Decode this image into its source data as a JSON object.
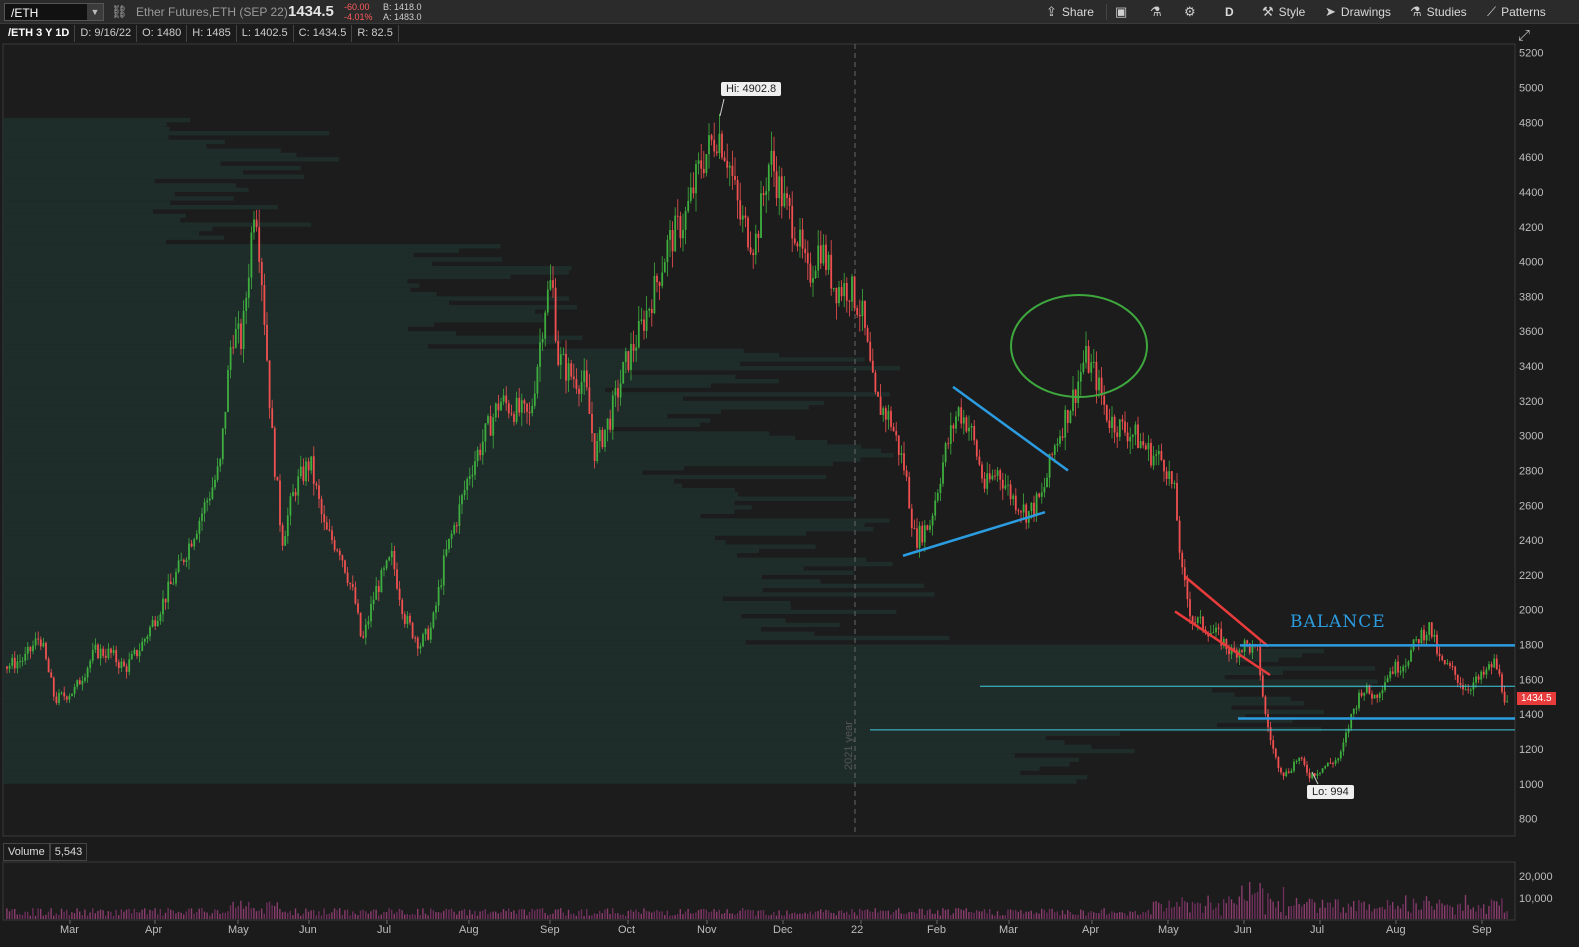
{
  "toolbar": {
    "symbol": "/ETH",
    "description": "Ether Futures,ETH (SEP 22)",
    "last": "1434.5",
    "change_net": "-60.00",
    "change_pct": "-4.01%",
    "bid": "B: 1418.0",
    "ask": "A: 1483.0",
    "share": "Share",
    "aggregation": "D",
    "style": "Style",
    "drawings": "Drawings",
    "studies": "Studies",
    "patterns": "Patterns"
  },
  "info": {
    "title": "/ETH 3 Y 1D",
    "date": "D: 9/16/22",
    "open": "O: 1480",
    "high": "H: 1485",
    "low": "L: 1402.5",
    "close": "C: 1434.5",
    "range": "R: 82.5"
  },
  "annotations": {
    "hi": "Hi: 4902.8",
    "lo": "Lo: 994",
    "balance": "BALANCE",
    "year_marker": "2021 year",
    "price_tag": "1434.5"
  },
  "volume": {
    "label": "Volume",
    "value": "5,543"
  },
  "chart_data": {
    "type": "candlestick",
    "y_ticks": [
      5200,
      5000,
      4800,
      4600,
      4400,
      4200,
      4000,
      3800,
      3600,
      3400,
      3200,
      3000,
      2800,
      2600,
      2400,
      2200,
      2000,
      1800,
      1600,
      1400,
      1200,
      1000,
      800
    ],
    "ylim": [
      700,
      5250
    ],
    "volume_ticks": [
      "20,000",
      "10,000"
    ],
    "x_months": [
      "Mar",
      "Apr",
      "May",
      "Jun",
      "Jul",
      "Aug",
      "Sep",
      "Oct",
      "Nov",
      "Dec",
      "22",
      "Feb",
      "Mar",
      "Apr",
      "May",
      "Jun",
      "Jul",
      "Aug",
      "Sep"
    ],
    "path": [
      [
        0,
        1660
      ],
      [
        25,
        1720
      ],
      [
        40,
        1850
      ],
      [
        55,
        1480
      ],
      [
        75,
        1540
      ],
      [
        95,
        1760
      ],
      [
        110,
        1750
      ],
      [
        125,
        1660
      ],
      [
        140,
        1780
      ],
      [
        160,
        2010
      ],
      [
        180,
        2250
      ],
      [
        205,
        2600
      ],
      [
        220,
        2820
      ],
      [
        232,
        3600
      ],
      [
        242,
        3540
      ],
      [
        250,
        4050
      ],
      [
        255,
        4400
      ],
      [
        262,
        3900
      ],
      [
        272,
        3000
      ],
      [
        282,
        2400
      ],
      [
        295,
        2700
      ],
      [
        310,
        2850
      ],
      [
        325,
        2450
      ],
      [
        340,
        2350
      ],
      [
        355,
        2050
      ],
      [
        362,
        1800
      ],
      [
        375,
        2100
      ],
      [
        392,
        2300
      ],
      [
        405,
        1950
      ],
      [
        420,
        1800
      ],
      [
        432,
        1900
      ],
      [
        445,
        2300
      ],
      [
        458,
        2550
      ],
      [
        470,
        2800
      ],
      [
        485,
        3000
      ],
      [
        500,
        3200
      ],
      [
        515,
        3150
      ],
      [
        530,
        3100
      ],
      [
        545,
        3750
      ],
      [
        552,
        3900
      ],
      [
        558,
        3450
      ],
      [
        570,
        3350
      ],
      [
        585,
        3300
      ],
      [
        595,
        2900
      ],
      [
        610,
        3100
      ],
      [
        625,
        3400
      ],
      [
        640,
        3600
      ],
      [
        655,
        3850
      ],
      [
        668,
        4100
      ],
      [
        685,
        4250
      ],
      [
        700,
        4550
      ],
      [
        718,
        4750
      ],
      [
        728,
        4600
      ],
      [
        740,
        4250
      ],
      [
        755,
        4100
      ],
      [
        770,
        4600
      ],
      [
        783,
        4350
      ],
      [
        795,
        4200
      ],
      [
        808,
        3900
      ],
      [
        820,
        4100
      ],
      [
        835,
        3850
      ],
      [
        850,
        3850
      ],
      [
        862,
        3700
      ],
      [
        875,
        3200
      ],
      [
        890,
        3100
      ],
      [
        905,
        2800
      ],
      [
        915,
        2400
      ],
      [
        930,
        2500
      ],
      [
        945,
        2900
      ],
      [
        958,
        3150
      ],
      [
        970,
        3050
      ],
      [
        985,
        2700
      ],
      [
        998,
        2800
      ],
      [
        1012,
        2650
      ],
      [
        1028,
        2550
      ],
      [
        1042,
        2650
      ],
      [
        1055,
        2950
      ],
      [
        1065,
        3100
      ],
      [
        1075,
        3250
      ],
      [
        1085,
        3450
      ],
      [
        1095,
        3350
      ],
      [
        1108,
        3100
      ],
      [
        1120,
        3050
      ],
      [
        1135,
        3000
      ],
      [
        1150,
        2900
      ],
      [
        1165,
        2850
      ],
      [
        1175,
        2650
      ],
      [
        1182,
        2200
      ],
      [
        1192,
        1950
      ],
      [
        1205,
        1900
      ],
      [
        1218,
        1850
      ],
      [
        1232,
        1750
      ],
      [
        1245,
        1800
      ],
      [
        1258,
        1750
      ],
      [
        1265,
        1400
      ],
      [
        1275,
        1150
      ],
      [
        1285,
        1050
      ],
      [
        1298,
        1150
      ],
      [
        1310,
        1050
      ],
      [
        1325,
        1100
      ],
      [
        1340,
        1150
      ],
      [
        1352,
        1400
      ],
      [
        1362,
        1550
      ],
      [
        1375,
        1500
      ],
      [
        1390,
        1650
      ],
      [
        1405,
        1700
      ],
      [
        1420,
        1850
      ],
      [
        1430,
        1900
      ],
      [
        1440,
        1700
      ],
      [
        1452,
        1650
      ],
      [
        1465,
        1550
      ],
      [
        1480,
        1600
      ],
      [
        1495,
        1700
      ],
      [
        1508,
        1434
      ]
    ],
    "lines": [
      {
        "color": "#2c9ce0",
        "from": [
          953,
          3280
        ],
        "to": [
          1068,
          2800
        ]
      },
      {
        "color": "#2c9ce0",
        "from": [
          903,
          2310
        ],
        "to": [
          1045,
          2560
        ]
      },
      {
        "color": "#e83b3b",
        "from": [
          1185,
          2190
        ],
        "to": [
          1268,
          1790
        ]
      },
      {
        "color": "#e83b3b",
        "from": [
          1175,
          1990
        ],
        "to": [
          1270,
          1625
        ]
      },
      {
        "color": "#2c9ce0",
        "from": [
          1240,
          1795
        ],
        "to": [
          1515,
          1795
        ]
      },
      {
        "color": "#2c9ce0",
        "from": [
          1238,
          1375
        ],
        "to": [
          1515,
          1375
        ]
      },
      {
        "color": "#40c8e0",
        "from": [
          980,
          1560
        ],
        "to": [
          1515,
          1560
        ]
      },
      {
        "color": "#40c8e0",
        "from": [
          870,
          1310
        ],
        "to": [
          1515,
          1310
        ]
      }
    ]
  }
}
